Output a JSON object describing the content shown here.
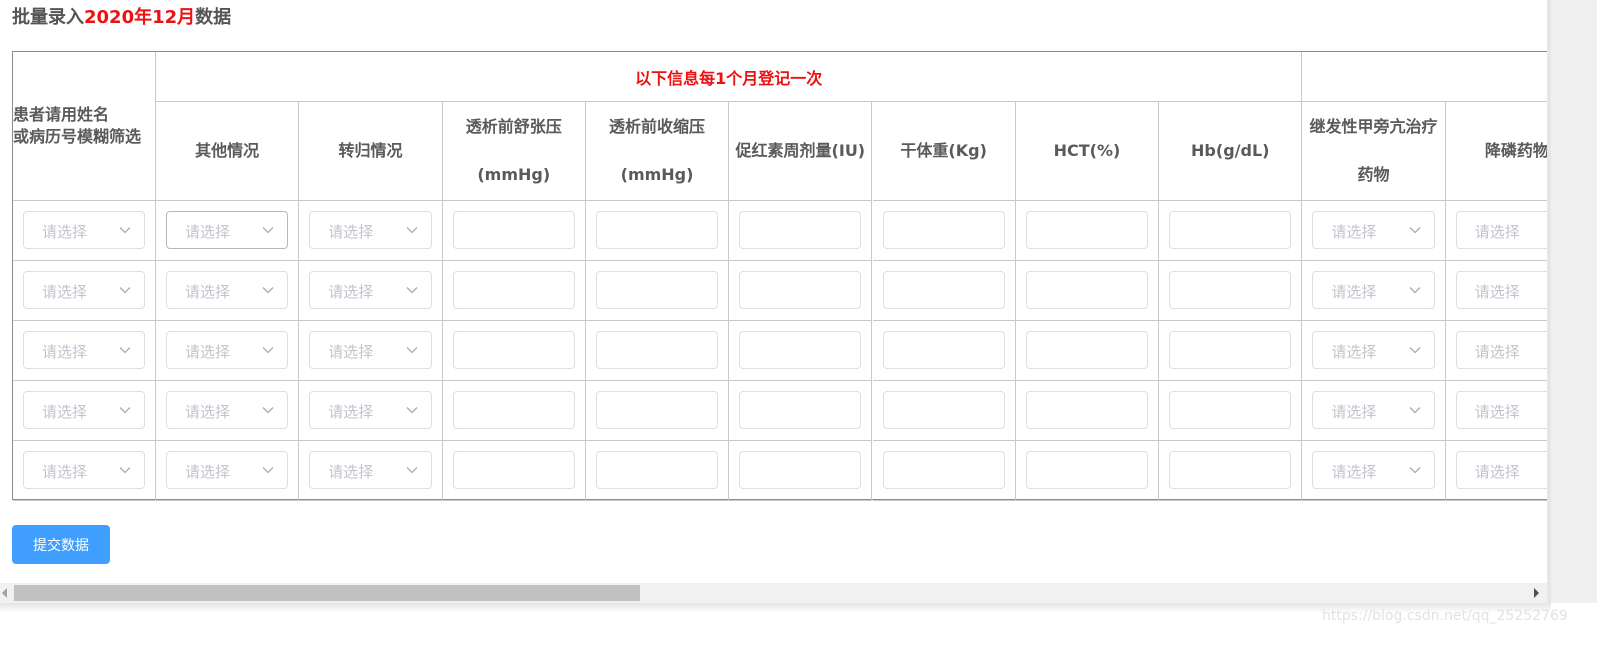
{
  "title": {
    "prefix": "批量录入",
    "period": "2020年12月",
    "suffix": "数据"
  },
  "table": {
    "first_header_line1": "患者请用姓名",
    "first_header_line2": "或病历号模糊筛选",
    "group_header": "以下信息每1个月登记一次",
    "columns": [
      {
        "line1": "其他情况",
        "line2": "",
        "kind": "select"
      },
      {
        "line1": "转归情况",
        "line2": "",
        "kind": "select"
      },
      {
        "line1": "透析前舒张压",
        "line2": "(mmHg)",
        "kind": "input"
      },
      {
        "line1": "透析前收缩压",
        "line2": "(mmHg)",
        "kind": "input"
      },
      {
        "line1": "促红素周剂量(IU)",
        "line2": "",
        "kind": "input"
      },
      {
        "line1": "干体重(Kg)",
        "line2": "",
        "kind": "input"
      },
      {
        "line1": "HCT(%)",
        "line2": "",
        "kind": "input"
      },
      {
        "line1": "Hb(g/dL)",
        "line2": "",
        "kind": "input"
      },
      {
        "line1": "继发性甲旁亢治疗",
        "line2": "药物",
        "kind": "select"
      },
      {
        "line1": "降磷药物",
        "line2": "",
        "kind": "select"
      }
    ],
    "select_placeholder": "请选择",
    "row_count": 5
  },
  "submit_button": "提交数据",
  "watermark": "https://blog.csdn.net/qq_25252769",
  "colors": {
    "accent": "#409eff",
    "highlight": "#ee1111"
  }
}
